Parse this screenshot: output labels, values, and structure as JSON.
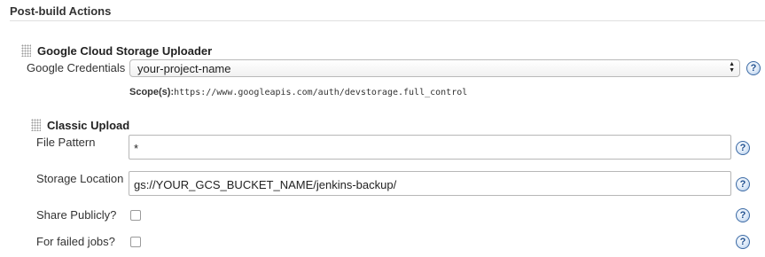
{
  "section": {
    "title": "Post-build Actions"
  },
  "gcs_uploader": {
    "title": "Google Cloud Storage Uploader",
    "credentials_label": "Google Credentials",
    "credentials_value": "your-project-name",
    "scope_label": "Scope(s):",
    "scope_value": "https://www.googleapis.com/auth/devstorage.full_control"
  },
  "classic_upload": {
    "title": "Classic Upload",
    "file_pattern_label": "File Pattern",
    "file_pattern_value": "*",
    "storage_location_label": "Storage Location",
    "storage_location_value": "gs://YOUR_GCS_BUCKET_NAME/jenkins-backup/",
    "share_publicly_label": "Share Publicly?",
    "share_publicly_checked": false,
    "failed_jobs_label": "For failed jobs?",
    "failed_jobs_checked": false
  },
  "icons": {
    "help": "help-icon",
    "drag": "drag-handle-icon",
    "select": "updown-arrows-icon"
  },
  "help_glyph": "?",
  "colors": {
    "help_blue": "#3d6ba5",
    "border": "#b7b7b7",
    "text": "#333333"
  }
}
